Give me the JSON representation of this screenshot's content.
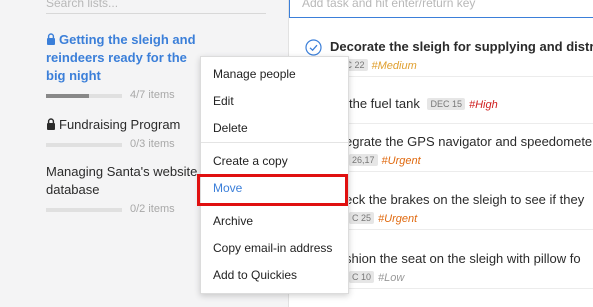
{
  "sidebar": {
    "search_placeholder": "Search lists...",
    "lists": [
      {
        "title": "Getting the sleigh and reindeers ready for the big night",
        "locked": true,
        "active": true,
        "progress_text": "4/7 items",
        "progress": 0.5714
      },
      {
        "title": "Fundraising Program",
        "locked": true,
        "active": false,
        "progress_text": "0/3 items",
        "progress": 0
      },
      {
        "title": "Managing Santa's website database",
        "locked": false,
        "active": false,
        "progress_text": "0/2 items",
        "progress": 0
      }
    ]
  },
  "main": {
    "add_placeholder": "Add task and hit enter/return key",
    "tasks": [
      {
        "title": "Decorate the sleigh for supplying and distributing",
        "date": "DEC 22",
        "tag": "#Medium"
      },
      {
        "title": "the fuel tank",
        "date": "DEC 15",
        "tag": "#High"
      },
      {
        "title": "egrate the GPS navigator and speedometer",
        "date": "26,17",
        "tag": "#Urgent"
      },
      {
        "title": "eck the brakes on the sleigh to see if they",
        "date": "C 25",
        "tag": "#Urgent"
      },
      {
        "title": "shion the seat on the sleigh with pillow fo",
        "date": "C 10",
        "tag": "#Low"
      }
    ]
  },
  "context_menu": {
    "items": [
      {
        "label": "Manage people"
      },
      {
        "label": "Edit"
      },
      {
        "label": "Delete"
      },
      {
        "label": "Create a copy"
      },
      {
        "label": "Move"
      },
      {
        "label": "Archive"
      },
      {
        "label": "Copy email-in address"
      },
      {
        "label": "Add to Quickies"
      }
    ]
  },
  "colors": {
    "accent": "#3b7fd9",
    "highlight": "#e01010"
  }
}
